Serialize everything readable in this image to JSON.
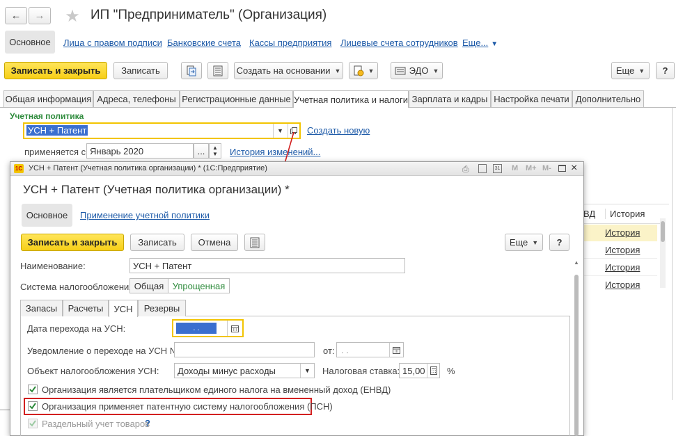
{
  "main": {
    "title": "ИП \"Предприниматель\" (Организация)",
    "nav": {
      "section_main": "Основное",
      "links": [
        "Лица с правом подписи",
        "Банковские счета",
        "Кассы предприятия",
        "Лицевые счета сотрудников",
        "Еще..."
      ]
    },
    "toolbar": {
      "save_close": "Записать и закрыть",
      "save": "Записать",
      "create_based": "Создать на основании",
      "edo": "ЭДО",
      "more": "Еще",
      "help": "?"
    },
    "tabs": [
      "Общая информация",
      "Адреса, телефоны",
      "Регистрационные данные",
      "Учетная политика и налоги",
      "Зарплата и кадры",
      "Настройка печати",
      "Дополнительно"
    ],
    "policy": {
      "heading": "Учетная политика",
      "value": "УСН + Патент",
      "create_new": "Создать новую",
      "applies_label": "применяется с:",
      "applies_value": "Январь 2020",
      "history_link": "История изменений..."
    },
    "background_table": {
      "col_partial": "ВД",
      "col_history": "История",
      "rows": [
        "История",
        "История",
        "История",
        "История"
      ]
    }
  },
  "dialog": {
    "window_title": "УСН + Патент (Учетная политика организации) * (1С:Предприятие)",
    "header_title": "УСН + Патент (Учетная политика организации) *",
    "nav_main": "Основное",
    "nav_apply": "Применение учетной политики",
    "toolbar": {
      "save_close": "Записать и закрыть",
      "save": "Записать",
      "cancel": "Отмена",
      "more": "Еще",
      "help": "?"
    },
    "title_buttons": [
      "M",
      "M+",
      "M-"
    ],
    "name_label": "Наименование:",
    "name_value": "УСН + Патент",
    "tax_system_label": "Система налогообложения:",
    "tax_system_options": [
      "Общая",
      "Упрощенная"
    ],
    "tabs": [
      "Запасы",
      "Расчеты",
      "УСН",
      "Резервы"
    ],
    "usn": {
      "transition_date_label": "Дата перехода на УСН:",
      "transition_date_value": ". .",
      "notice_label": "Уведомление о переходе на УСН №:",
      "from_label": "от:",
      "from_value": ". .",
      "object_label": "Объект налогообложения УСН:",
      "object_value": "Доходы минус расходы",
      "rate_label": "Налоговая ставка:",
      "rate_value": "15,00",
      "rate_unit": "%"
    },
    "checkboxes": [
      {
        "label": "Организация является плательщиком единого налога на вмененный доход (ЕНВД)",
        "checked": true
      },
      {
        "label": "Организация применяет патентную систему налогообложения (ПСН)",
        "checked": true
      },
      {
        "label": "Раздельный учет товаров",
        "checked": true
      }
    ],
    "help_mark": "?"
  },
  "colors": {
    "accent_yellow": "#f7cf17",
    "link_blue": "#1d5aa8",
    "highlight_red": "#d21f1f",
    "check_green": "#2e8b3c"
  }
}
